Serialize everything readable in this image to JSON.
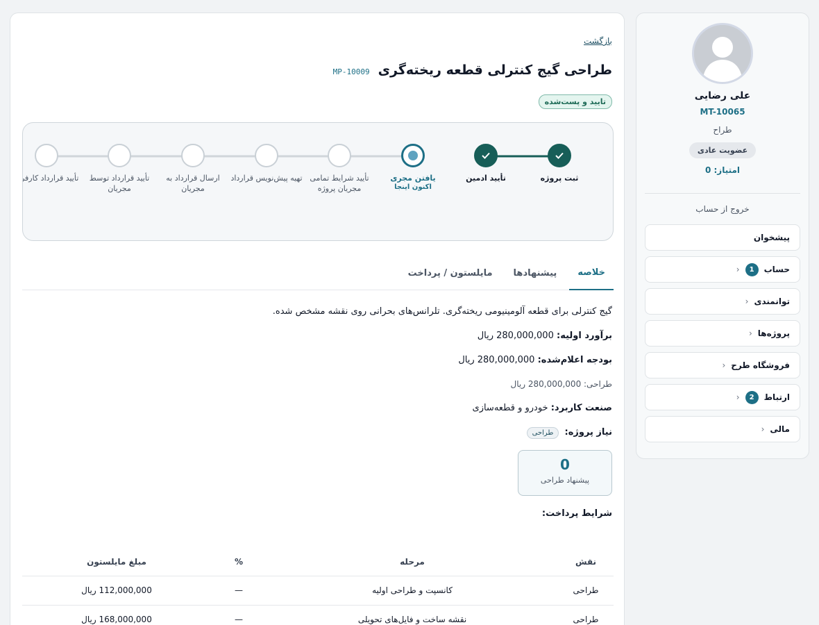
{
  "sidebar": {
    "user_name": "علی رضایی",
    "user_code": "MT-10065",
    "user_role": "طراح",
    "membership": "عضویت عادی",
    "score": "امتیاز: 0",
    "logout": "خروج از حساب",
    "menu": [
      {
        "label": "پیشخوان",
        "badge": null,
        "chevron": false
      },
      {
        "label": "حساب",
        "badge": "1",
        "chevron": true
      },
      {
        "label": "توانمندی",
        "badge": null,
        "chevron": true
      },
      {
        "label": "پروژه‌ها",
        "badge": null,
        "chevron": true
      },
      {
        "label": "فروشگاه طرح",
        "badge": null,
        "chevron": true
      },
      {
        "label": "ارتباط",
        "badge": "2",
        "chevron": true
      },
      {
        "label": "مالی",
        "badge": null,
        "chevron": true
      }
    ]
  },
  "main": {
    "back_label": "بازگشت",
    "title": "طراحی گیج کنترلی قطعه ریخته‌گری",
    "project_code": "MP-10009",
    "status": "تایید و پست‌شده",
    "stepper": [
      {
        "label": "ثبت پروژه",
        "state": "done"
      },
      {
        "label": "تأیید ادمین",
        "state": "done"
      },
      {
        "label": "یافتن مجری",
        "state": "current",
        "sub": "اکنون اینجا"
      },
      {
        "label": "تأیید شرایط تمامی مجریان پروژه",
        "state": "pending"
      },
      {
        "label": "تهیه پیش‌نویس قرارداد",
        "state": "pending"
      },
      {
        "label": "ارسال قرارداد به مجریان",
        "state": "pending"
      },
      {
        "label": "تأیید قرارداد توسط مجریان",
        "state": "pending"
      },
      {
        "label": "تأیید قرارداد کارفرما",
        "state": "pending"
      }
    ],
    "tabs": [
      {
        "label": "خلاصه",
        "active": true
      },
      {
        "label": "پیشنهادها",
        "active": false
      },
      {
        "label": "مایلستون / پرداخت",
        "active": false
      }
    ],
    "summary": {
      "description": "گیج کنترلی برای قطعه آلومینیومی ریخته‌گری. تلرانس‌های بحرانی روی نقشه مشخص شده.",
      "initial_estimate_label": "برآورد اولیه:",
      "initial_estimate_value": "280,000,000 ریال",
      "announced_budget_label": "بودجه اعلام‌شده:",
      "announced_budget_value": "280,000,000 ریال",
      "design_budget": "طراحی: 280,000,000 ریال",
      "industry_label": "صنعت کاربرد:",
      "industry_value": "خودرو و قطعه‌سازی",
      "need_label": "نیاز پروژه:",
      "need_tag": "طراحی",
      "stat_value": "0",
      "stat_label": "پیشنهاد طراحی",
      "payment_title": "شرایط پرداخت:"
    },
    "payment_table": {
      "headers": [
        "نقش",
        "مرحله",
        "%",
        "مبلغ مایلستون"
      ],
      "rows": [
        [
          "طراحی",
          "کانسپت و طراحی اولیه",
          "—",
          "112,000,000 ریال"
        ],
        [
          "طراحی",
          "نقشه ساخت و فایل‌های تحویلی",
          "—",
          "168,000,000 ریال"
        ]
      ]
    }
  },
  "colors": {
    "accent": "#1d6f86",
    "done": "#175e58",
    "status_bg": "#e4f5ef"
  }
}
